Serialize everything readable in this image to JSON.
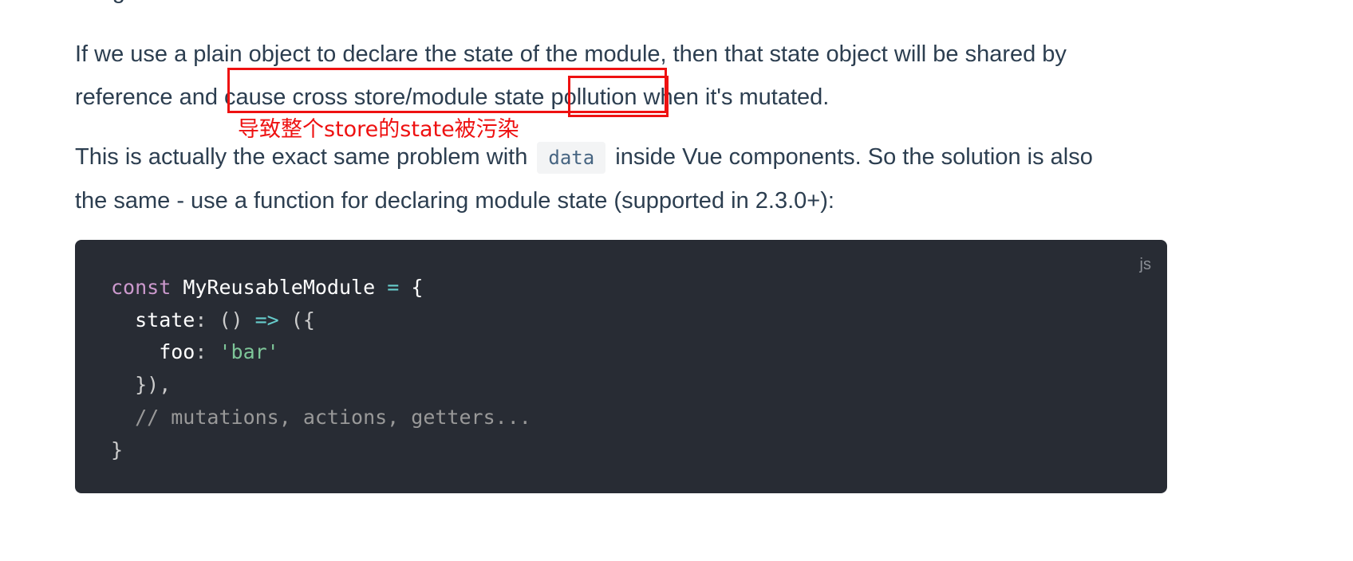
{
  "cutoff_line": "thing at the main module",
  "paragraph1": {
    "line1": "If we use a plain object to declare the state of the module, then that state object will be shared by",
    "line2_start": "reference and ",
    "highlight_text": "cause cross store/module state ",
    "highlight_word": "pollution",
    "line2_end": " when it's mutated."
  },
  "annotation": {
    "note": "导致整个store的state被污染",
    "color": "#ee1111"
  },
  "paragraph2": {
    "line1_start": "This is actually the exact same problem with ",
    "inline_code": "data",
    "line1_end": " inside Vue components. So the solution is also",
    "line2": "the same - use a function for declaring module state (supported in 2.3.0+):"
  },
  "code_block": {
    "language": "js",
    "line1": {
      "kw": "const",
      "name": " MyReusableModule ",
      "op": "=",
      "rest": " {"
    },
    "line2": {
      "prop": "  state",
      "colon": ":",
      "parens": " ()",
      "arrow": " =>",
      "rest": " ({"
    },
    "line3": {
      "prop": "    foo",
      "colon": ":",
      "str": " 'bar'"
    },
    "line4": "  }),",
    "line5": "  // mutations, actions, getters...",
    "line6": "}"
  }
}
